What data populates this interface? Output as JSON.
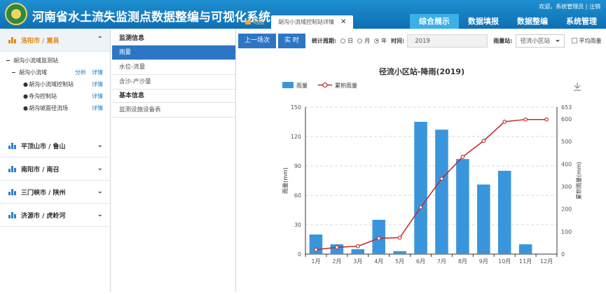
{
  "header": {
    "title": "河南省水土流失监测点数据整编与可视化系统",
    "welcome": "欢迎，系统管理员 | 注销",
    "nav": [
      "综合展示",
      "数据填报",
      "数据整编",
      "系统管理"
    ],
    "tabs": [
      {
        "label": "地图"
      },
      {
        "label": "胡沟小流域控制站详情"
      }
    ]
  },
  "sidebar": {
    "regions": [
      "洛阳市 / 嵩县",
      "平顶山市 / 鲁山",
      "南阳市 / 南召",
      "三门峡市 / 陕州",
      "济源市 / 虎岭河"
    ],
    "tree": {
      "root": "胡沟小流域监测站",
      "group": "胡沟小流域",
      "group_actions": [
        "分析",
        "详情"
      ],
      "stations": [
        {
          "name": "胡沟小流域控制站",
          "action": "详情"
        },
        {
          "name": "寺沟控制站",
          "action": "详情"
        },
        {
          "name": "胡沟坡面径流场",
          "action": "详情"
        }
      ]
    }
  },
  "menu": {
    "groups": [
      {
        "title": "监测信息",
        "items": [
          "雨量",
          "水位-流量",
          "含沙-产沙量"
        ]
      },
      {
        "title": "基本信息",
        "items": [
          "监测设施设备表"
        ]
      }
    ]
  },
  "toolbar": {
    "prev": "上一场次",
    "realtime": "实 时",
    "period_label": "统计周期:",
    "period_options": [
      "日",
      "月",
      "年"
    ],
    "time_label": "时间:",
    "time_value": "2019",
    "station_label": "雨量站:",
    "station_value": "径流小区站",
    "avg_label": "平均雨量"
  },
  "colors": {
    "bar": "#3a96dc",
    "line": "#c0282b",
    "nav_active": "#39b0e6",
    "button": "#2d76c6"
  },
  "chart_data": {
    "type": "bar",
    "title": "径流小区站-降雨(2019)",
    "categories": [
      "1月",
      "2月",
      "3月",
      "4月",
      "5月",
      "6月",
      "7月",
      "8月",
      "9月",
      "10月",
      "11月",
      "12月"
    ],
    "series": [
      {
        "name": "雨量",
        "type": "bar",
        "axis": "left",
        "values": [
          20,
          10,
          5,
          35,
          3,
          135,
          127,
          97,
          71,
          85,
          10,
          0
        ]
      },
      {
        "name": "累积雨量",
        "type": "line",
        "axis": "right",
        "values": [
          20,
          30,
          35,
          70,
          73,
          208,
          335,
          432,
          503,
          588,
          598,
          598
        ]
      }
    ],
    "ylabel": "雨量(mm)",
    "y2label": "累积雨量(mm)",
    "ylim": [
      0,
      150
    ],
    "y2lim": [
      0,
      653
    ],
    "yticks": [
      0,
      30,
      60,
      90,
      120,
      150
    ],
    "y2ticks": [
      0,
      100,
      200,
      300,
      400,
      500,
      600,
      653
    ],
    "legend": "top-left",
    "grid": true
  }
}
